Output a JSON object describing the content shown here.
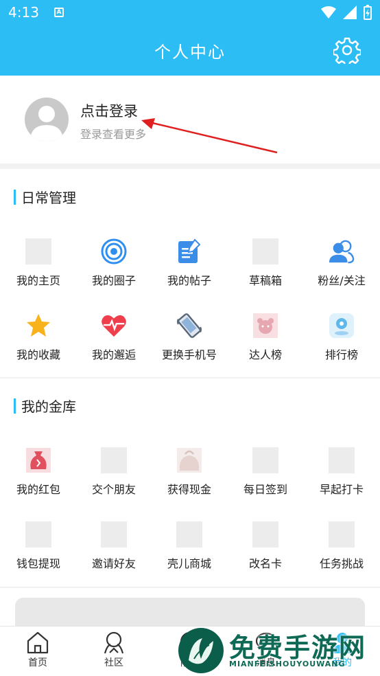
{
  "status_bar": {
    "time": "4:13",
    "notif_icon": "A"
  },
  "header": {
    "title": "个人中心",
    "settings_icon": "gear-icon"
  },
  "profile": {
    "login_label": "点击登录",
    "login_hint": "登录查看更多"
  },
  "daily": {
    "title": "日常管理",
    "items": [
      {
        "label": "我的主页",
        "icon": "placeholder"
      },
      {
        "label": "我的圈子",
        "icon": "circle-target-icon"
      },
      {
        "label": "我的帖子",
        "icon": "edit-note-icon"
      },
      {
        "label": "草稿箱",
        "icon": "placeholder"
      },
      {
        "label": "粉丝/关注",
        "icon": "users-icon"
      },
      {
        "label": "我的收藏",
        "icon": "star-icon"
      },
      {
        "label": "我的邂逅",
        "icon": "heartbeat-icon"
      },
      {
        "label": "更换手机号",
        "icon": "phone-icon"
      },
      {
        "label": "达人榜",
        "icon": "bear-icon"
      },
      {
        "label": "排行榜",
        "icon": "location-icon"
      }
    ]
  },
  "vault": {
    "title": "我的金库",
    "items": [
      {
        "label": "我的红包",
        "icon": "red-packet-icon"
      },
      {
        "label": "交个朋友",
        "icon": "placeholder"
      },
      {
        "label": "获得现金",
        "icon": "purse-icon"
      },
      {
        "label": "每日签到",
        "icon": "placeholder"
      },
      {
        "label": "早起打卡",
        "icon": "placeholder"
      },
      {
        "label": "钱包提现",
        "icon": "placeholder"
      },
      {
        "label": "邀请好友",
        "icon": "placeholder"
      },
      {
        "label": "壳儿商城",
        "icon": "placeholder"
      },
      {
        "label": "改名卡",
        "icon": "placeholder"
      },
      {
        "label": "任务挑战",
        "icon": "placeholder"
      }
    ]
  },
  "bottom_nav": [
    {
      "label": "首页",
      "icon": "home-icon"
    },
    {
      "label": "社区",
      "icon": "community-icon"
    },
    {
      "label": "隆玩",
      "icon": "play-icon"
    },
    {
      "label": "消息",
      "icon": "message-icon"
    },
    {
      "label": "我的",
      "icon": "profile-icon"
    }
  ],
  "watermark": {
    "title": "免费手游网",
    "subtitle": "MIANFEISHOUYOUWANG"
  },
  "colors": {
    "brand": "#2dbdf5",
    "arrow": "#e02020"
  }
}
